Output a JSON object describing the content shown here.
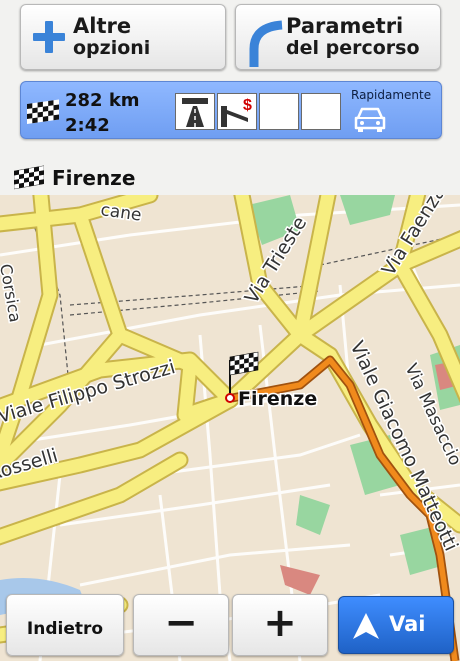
{
  "top_buttons": {
    "more_options": {
      "line1": "Altre",
      "line2": "opzioni"
    },
    "route_params": {
      "line1": "Parametri",
      "line2": "del percorso"
    }
  },
  "summary": {
    "distance": "282  km",
    "time": "2:42",
    "method": "Rapidamente"
  },
  "destination": {
    "name": "Firenze"
  },
  "map": {
    "streets": [
      "Via Trieste",
      "Via Faenza",
      "Viale Filippo Strozzi",
      "Viale Rosselli",
      "Viale Giacomo Matteotti",
      "Via Masaccio",
      "Corsica",
      "cane"
    ],
    "marker_label": "Firenze"
  },
  "bottom": {
    "back_label": "Indietro",
    "zoom_out": "−",
    "zoom_in": "+",
    "go_label": "Vai"
  },
  "colors": {
    "road": "#f7ee80",
    "route": "#f08a1c",
    "park": "#98d6a0",
    "accent": "#2a70d6"
  }
}
